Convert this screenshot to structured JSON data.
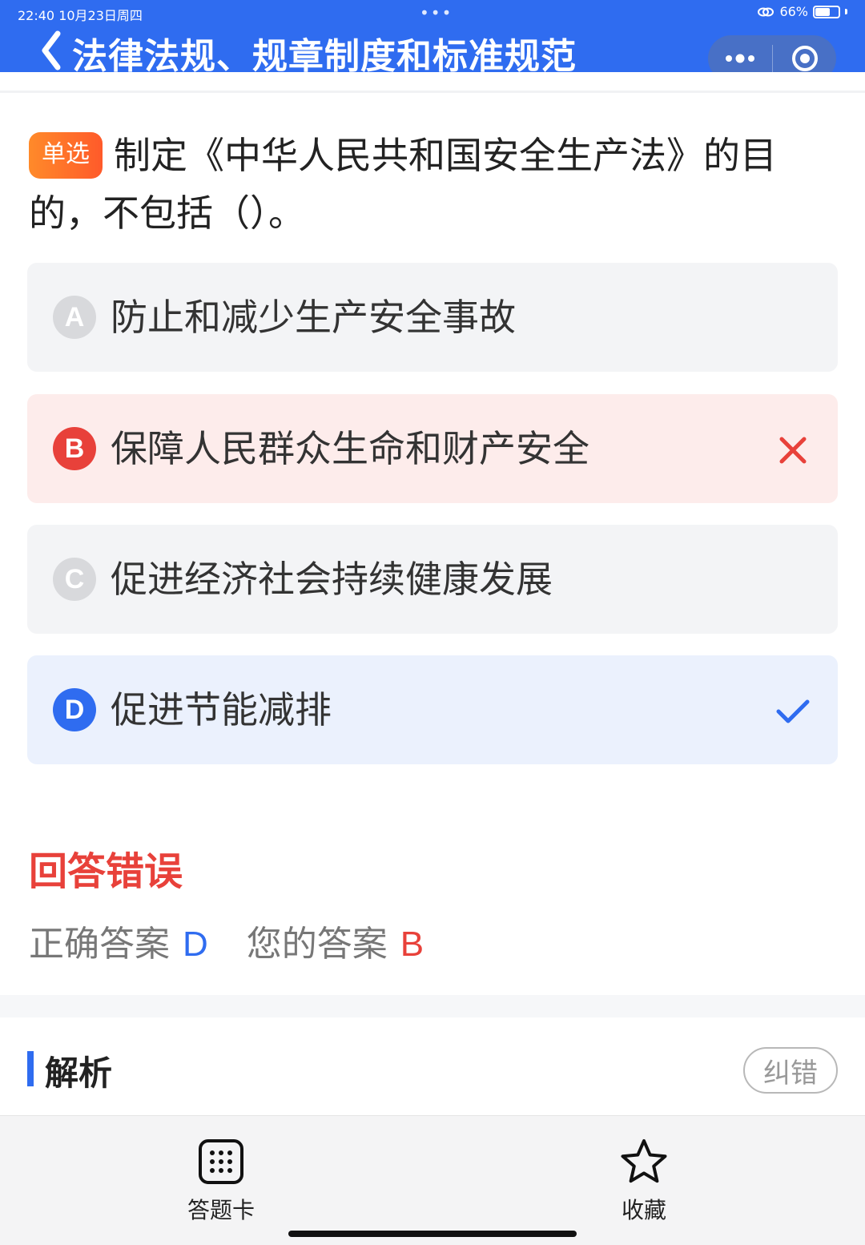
{
  "status_bar": {
    "time_date": "22:40   10月23日周四",
    "dots": "•••",
    "battery": "66%",
    "battery_level": 0.66
  },
  "header": {
    "title": "法律法规、规章制度和标准规范",
    "icons": [
      "back-icon",
      "more-icon",
      "close-target-icon"
    ]
  },
  "question": {
    "type_badge": "单选",
    "text": "制定《中华人民共和国安全生产法》的目的，不包括（）。"
  },
  "options": [
    {
      "letter": "A",
      "text": "防止和减少生产安全事故",
      "state": "normal"
    },
    {
      "letter": "B",
      "text": "保障人民群众生命和财产安全",
      "state": "wrong",
      "mark_icon": "cross-icon"
    },
    {
      "letter": "C",
      "text": "促进经济社会持续健康发展",
      "state": "normal"
    },
    {
      "letter": "D",
      "text": "促进节能减排",
      "state": "correct",
      "mark_icon": "check-icon"
    }
  ],
  "result": {
    "title": "回答错误",
    "correct_label": "正确答案",
    "correct_value": "D",
    "user_label": "您的答案",
    "user_value": "B"
  },
  "analysis": {
    "title": "解析",
    "report_button": "纠错"
  },
  "bottom_bar": {
    "card_label": "答题卡",
    "favorite_label": "收藏"
  },
  "colors": {
    "header_blue": "#2f6cf0",
    "wrong_red": "#e8413a",
    "badge_orange": "#ff6a2a",
    "wrong_bg": "#fdeceb",
    "correct_bg": "#ebf1fd",
    "option_bg": "#f3f4f6"
  }
}
